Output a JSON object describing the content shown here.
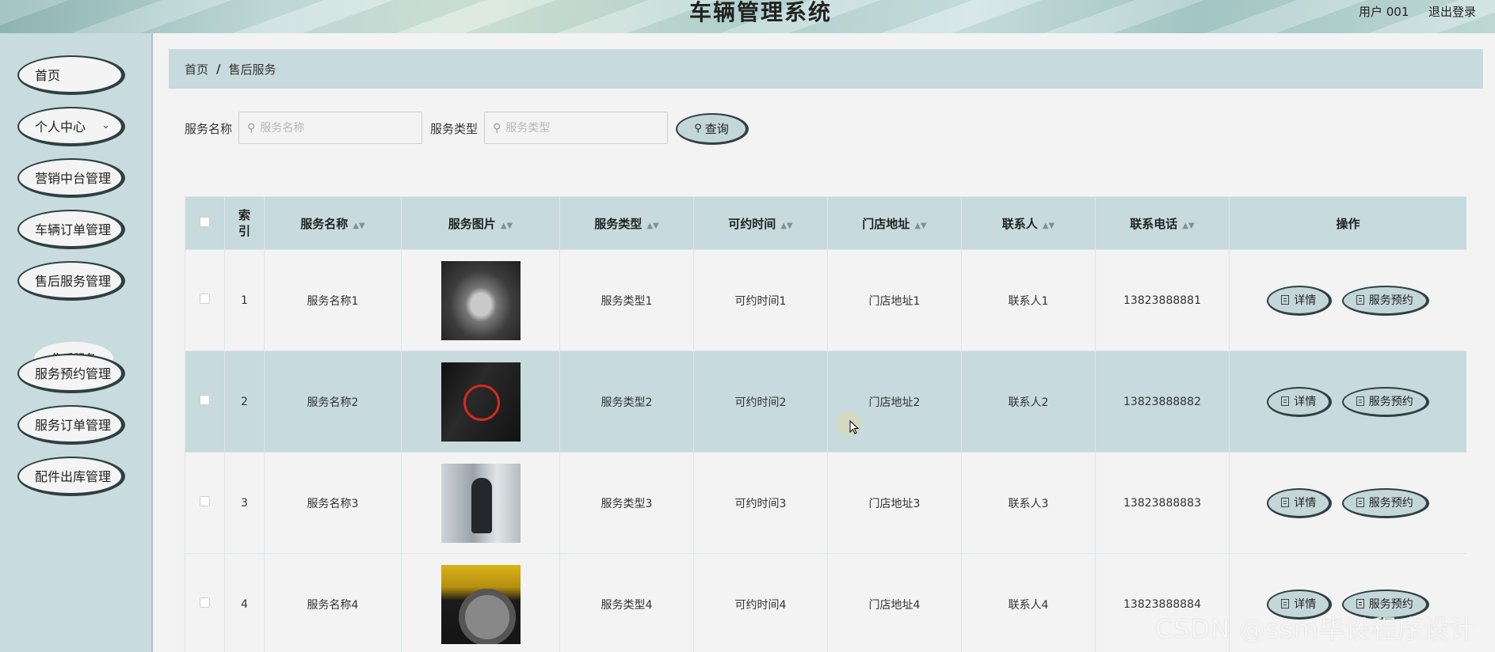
{
  "header": {
    "title": "车辆管理系统",
    "user_label": "用户 001",
    "logout_label": "退出登录"
  },
  "sidebar": {
    "items": [
      {
        "label": "首页"
      },
      {
        "label": "个人中心",
        "icon": "chevron-down-icon"
      },
      {
        "label": "营销中台管理"
      },
      {
        "label": "车辆订单管理"
      },
      {
        "label": "售后服务管理"
      },
      {
        "label": "服务预约管理"
      },
      {
        "label": "服务订单管理"
      },
      {
        "label": "配件出库管理"
      }
    ],
    "sub_item": {
      "label": "售后服务"
    }
  },
  "breadcrumb": {
    "home": "首页",
    "separator": "/",
    "current": "售后服务"
  },
  "search": {
    "name_label": "服务名称",
    "name_placeholder": "服务名称",
    "name_value": "",
    "type_label": "服务类型",
    "type_placeholder": "服务类型",
    "type_value": "",
    "query_label": "查询"
  },
  "table": {
    "columns": [
      "索引",
      "服务名称",
      "服务图片",
      "服务类型",
      "可约时间",
      "门店地址",
      "联系人",
      "联系电话",
      "操作"
    ],
    "detail_label": "详情",
    "book_label": "服务预约",
    "rows": [
      {
        "index": "1",
        "name": "服务名称1",
        "type": "服务类型1",
        "time": "可约时间1",
        "address": "门店地址1",
        "contact": "联系人1",
        "phone": "13823888881"
      },
      {
        "index": "2",
        "name": "服务名称2",
        "type": "服务类型2",
        "time": "可约时间2",
        "address": "门店地址2",
        "contact": "联系人2",
        "phone": "13823888882"
      },
      {
        "index": "3",
        "name": "服务名称3",
        "type": "服务类型3",
        "time": "可约时间3",
        "address": "门店地址3",
        "contact": "联系人3",
        "phone": "13823888883"
      },
      {
        "index": "4",
        "name": "服务名称4",
        "type": "服务类型4",
        "time": "可约时间4",
        "address": "门店地址4",
        "contact": "联系人4",
        "phone": "13823888884"
      }
    ]
  },
  "watermark": "CSDN @ssm毕设程序设计"
}
